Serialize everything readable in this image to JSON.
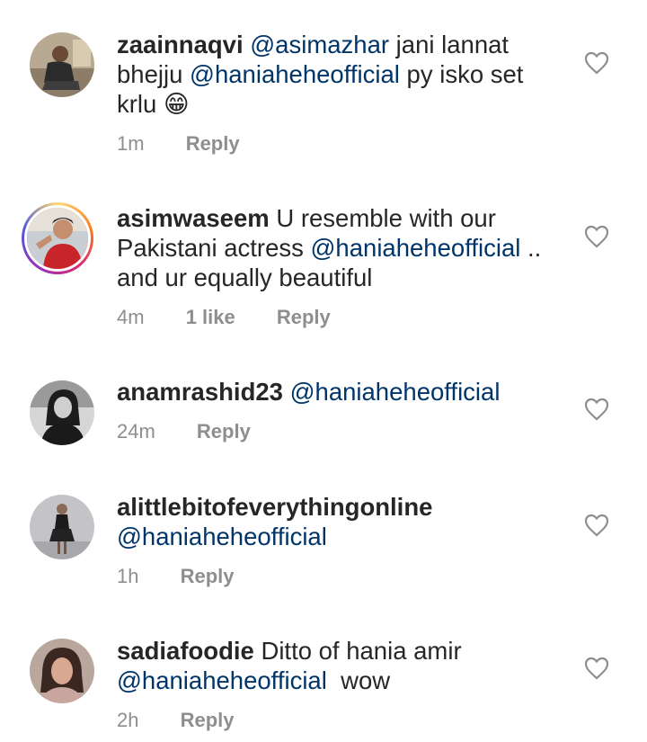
{
  "comments": [
    {
      "username": "zaainnaqvi",
      "segments": [
        {
          "type": "mention",
          "text": "@asimazhar"
        },
        {
          "type": "text",
          "text": " jani lannat bhejju "
        },
        {
          "type": "mention",
          "text": "@haniaheheofficial"
        },
        {
          "type": "text",
          "text": " py isko set krlu "
        },
        {
          "type": "emoji",
          "text": "😁"
        }
      ],
      "time": "1m",
      "likes": "",
      "reply_label": "Reply",
      "avatar_icon": "avatar-man-sitting"
    },
    {
      "username": "asimwaseem",
      "segments": [
        {
          "type": "text",
          "text": " U resemble with our Pakistani actress "
        },
        {
          "type": "mention",
          "text": "@haniaheheofficial"
        },
        {
          "type": "text",
          "text": " .. and ur equally beautiful"
        }
      ],
      "time": "4m",
      "likes": "1 like",
      "reply_label": "Reply",
      "avatar_icon": "avatar-man-story-ring"
    },
    {
      "username": "anamrashid23",
      "segments": [
        {
          "type": "text",
          "text": " "
        },
        {
          "type": "mention",
          "text": "@haniaheheofficial"
        }
      ],
      "time": "24m",
      "likes": "",
      "reply_label": "Reply",
      "avatar_icon": "avatar-woman-bw"
    },
    {
      "username": "alittlebitofeverythingonline",
      "segments": [
        {
          "type": "text",
          "text": " "
        },
        {
          "type": "mention",
          "text": "@haniaheheofficial"
        }
      ],
      "time": "1h",
      "likes": "",
      "reply_label": "Reply",
      "avatar_icon": "avatar-woman-dress"
    },
    {
      "username": "sadiafoodie",
      "segments": [
        {
          "type": "text",
          "text": " Ditto of hania amir "
        },
        {
          "type": "mention",
          "text": "@haniaheheofficial"
        },
        {
          "type": "text",
          "text": "  wow"
        }
      ],
      "time": "2h",
      "likes": "",
      "reply_label": "Reply",
      "avatar_icon": "avatar-woman"
    }
  ],
  "colors": {
    "text": "#262626",
    "mention": "#003569",
    "meta": "#8e8e8e"
  }
}
